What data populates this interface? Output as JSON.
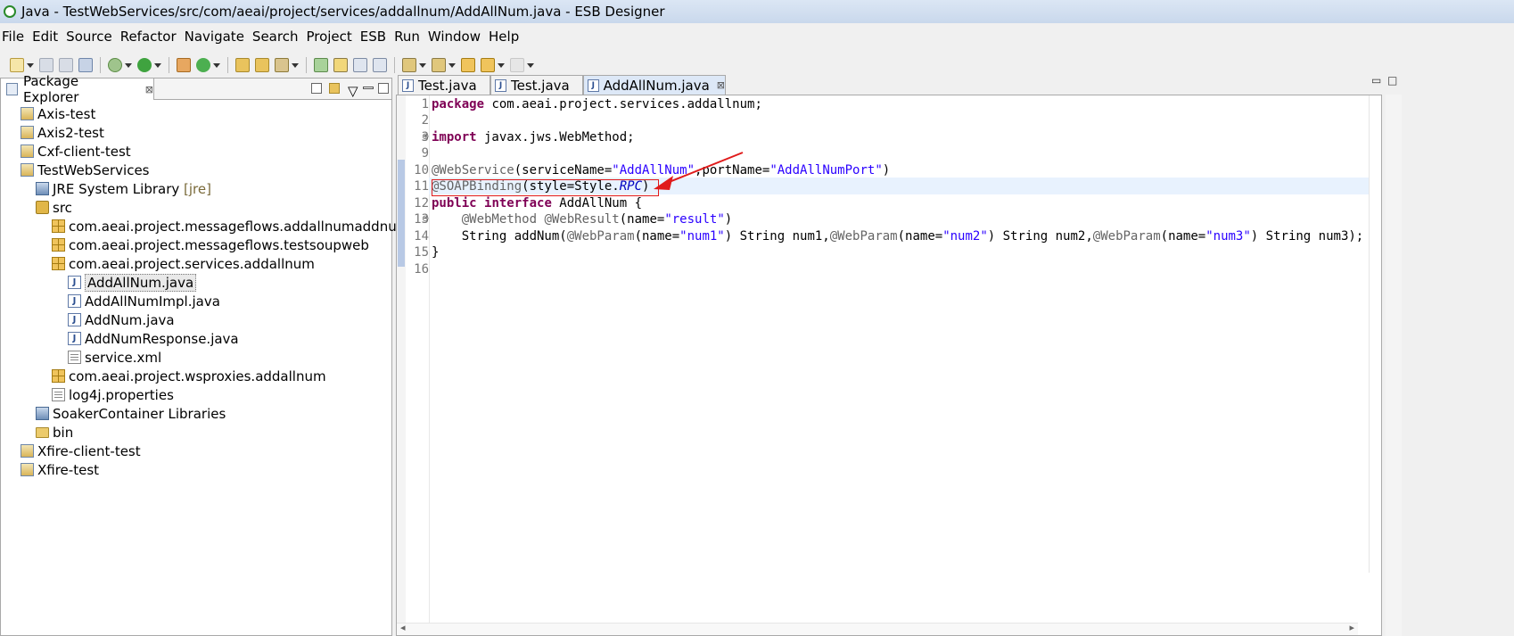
{
  "window": {
    "title": "Java - TestWebServices/src/com/aeai/project/services/addallnum/AddAllNum.java - ESB Designer"
  },
  "menu": [
    "File",
    "Edit",
    "Source",
    "Refactor",
    "Navigate",
    "Search",
    "Project",
    "ESB",
    "Run",
    "Window",
    "Help"
  ],
  "explorer": {
    "tab_label": "Package Explorer",
    "close_glyph": "⊠",
    "tree": [
      {
        "label": "Axis-test",
        "icon": "project-icon"
      },
      {
        "label": "Axis2-test",
        "icon": "project-icon"
      },
      {
        "label": "Cxf-client-test",
        "icon": "project-icon"
      },
      {
        "label": "TestWebServices",
        "icon": "project-icon"
      },
      {
        "label": "JRE System Library",
        "suffix": "[jre]",
        "icon": "library-icon"
      },
      {
        "label": "src",
        "icon": "source-folder-icon"
      },
      {
        "label": "com.aeai.project.messageflows.addallnumaddnum",
        "icon": "package-icon"
      },
      {
        "label": "com.aeai.project.messageflows.testsoupweb",
        "icon": "package-icon"
      },
      {
        "label": "com.aeai.project.services.addallnum",
        "icon": "package-icon"
      },
      {
        "label": "AddAllNum.java",
        "icon": "java-file-icon",
        "selected": true
      },
      {
        "label": "AddAllNumImpl.java",
        "icon": "java-file-icon"
      },
      {
        "label": "AddNum.java",
        "icon": "java-file-icon"
      },
      {
        "label": "AddNumResponse.java",
        "icon": "java-file-icon"
      },
      {
        "label": "service.xml",
        "icon": "xml-file-icon"
      },
      {
        "label": "com.aeai.project.wsproxies.addallnum",
        "icon": "package-icon"
      },
      {
        "label": "log4j.properties",
        "icon": "properties-file-icon"
      },
      {
        "label": "SoakerContainer Libraries",
        "icon": "library-icon"
      },
      {
        "label": "bin",
        "icon": "folder-icon"
      },
      {
        "label": "Xfire-client-test",
        "icon": "project-icon"
      },
      {
        "label": "Xfire-test",
        "icon": "project-icon"
      }
    ]
  },
  "editor": {
    "tabs": [
      {
        "label": "Test.java",
        "active": false
      },
      {
        "label": "Test.java",
        "active": false
      },
      {
        "label": "AddAllNum.java",
        "active": true
      }
    ],
    "close_glyph": "⊠",
    "line_numbers": [
      "1",
      "2",
      "3",
      "9",
      "10",
      "11",
      "12",
      "13",
      "14",
      "15",
      "16"
    ],
    "lines": [
      {
        "t": "package com.aeai.project.services.addallnum;"
      },
      {
        "t": ""
      },
      {
        "t": "import javax.jws.WebMethod;"
      },
      {
        "t": ""
      },
      {
        "t": "@WebService(serviceName=\"AddAllNum\",portName=\"AddAllNumPort\")"
      },
      {
        "t": "@SOAPBinding(style=Style.RPC)"
      },
      {
        "t": "public interface AddAllNum {"
      },
      {
        "t": "    @WebMethod @WebResult(name=\"result\")"
      },
      {
        "t": "    String addNum(@WebParam(name=\"num1\") String num1,@WebParam(name=\"num2\") String num2,@WebParam(name=\"num3\") String num3);"
      },
      {
        "t": "}"
      },
      {
        "t": ""
      }
    ],
    "fold_glyphs": {
      "line3": "⊕",
      "line13": "⊖"
    }
  },
  "colors": {
    "keyword": "#7f0055",
    "string": "#2a00ff",
    "annotation": "#646464",
    "highlight_box": "#e01b1b"
  }
}
